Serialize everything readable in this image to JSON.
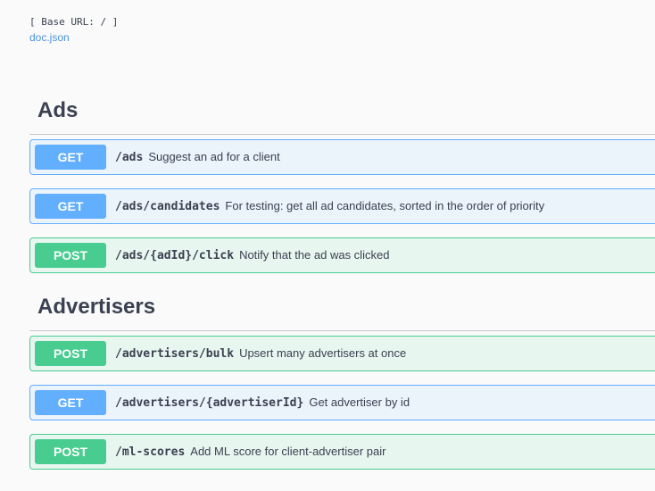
{
  "info": {
    "base_url": "[ Base URL: / ]",
    "doc_link": "doc.json"
  },
  "tags": [
    {
      "name": "Ads",
      "operations": [
        {
          "method": "GET",
          "path": "/ads",
          "summary": "Suggest an ad for a client"
        },
        {
          "method": "GET",
          "path": "/ads/candidates",
          "summary": "For testing: get all ad candidates, sorted in the order of priority"
        },
        {
          "method": "POST",
          "path": "/ads/{adId}/click",
          "summary": "Notify that the ad was clicked"
        }
      ]
    },
    {
      "name": "Advertisers",
      "operations": [
        {
          "method": "POST",
          "path": "/advertisers/bulk",
          "summary": "Upsert many advertisers at once"
        },
        {
          "method": "GET",
          "path": "/advertisers/{advertiserId}",
          "summary": "Get advertiser by id"
        },
        {
          "method": "POST",
          "path": "/ml-scores",
          "summary": "Add ML score for client-advertiser pair"
        }
      ]
    }
  ],
  "colors": {
    "get": "#61affe",
    "post": "#49cc90",
    "link": "#4990e2"
  }
}
